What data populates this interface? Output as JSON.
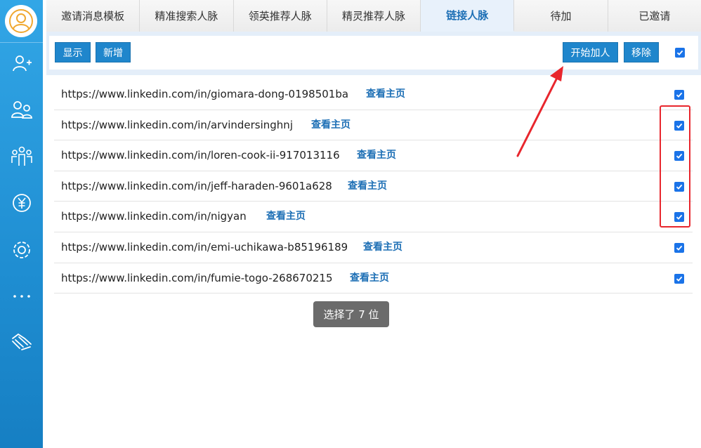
{
  "sidebar": {
    "icons": [
      "user-avatar-icon",
      "add-user-icon",
      "users-group-icon",
      "team-icon",
      "yen-icon",
      "settings-gear-icon",
      "more-icon",
      "handshake-icon"
    ]
  },
  "tabs": [
    {
      "label": "邀请消息模板",
      "active": false
    },
    {
      "label": "精准搜索人脉",
      "active": false
    },
    {
      "label": "领英推荐人脉",
      "active": false
    },
    {
      "label": "精灵推荐人脉",
      "active": false
    },
    {
      "label": "链接人脉",
      "active": true
    },
    {
      "label": "待加",
      "active": false
    },
    {
      "label": "已邀请",
      "active": false
    }
  ],
  "toolbar": {
    "show_label": "显示",
    "add_label": "新增",
    "start_label": "开始加人",
    "remove_label": "移除",
    "select_all_checked": true
  },
  "rows": [
    {
      "url": "https://www.linkedin.com/in/giomara-dong-0198501ba",
      "view_label": "查看主页",
      "checked": true
    },
    {
      "url": "https://www.linkedin.com/in/arvindersinghnj",
      "view_label": "查看主页",
      "checked": true
    },
    {
      "url": "https://www.linkedin.com/in/loren-cook-ii-917013116",
      "view_label": "查看主页",
      "checked": true
    },
    {
      "url": "https://www.linkedin.com/in/jeff-haraden-9601a628",
      "view_label": "查看主页",
      "checked": true
    },
    {
      "url": "https://www.linkedin.com/in/nigyan",
      "view_label": "查看主页",
      "checked": true
    },
    {
      "url": "https://www.linkedin.com/in/emi-uchikawa-b85196189",
      "view_label": "查看主页",
      "checked": true
    },
    {
      "url": "https://www.linkedin.com/in/fumie-togo-268670215",
      "view_label": "查看主页",
      "checked": true
    }
  ],
  "toast": {
    "text": "选择了 7 位"
  },
  "colors": {
    "accent": "#1f86cc",
    "sidebar": "#2a9ad9",
    "highlight": "#e8262d",
    "checkbox": "#1a73e8"
  }
}
